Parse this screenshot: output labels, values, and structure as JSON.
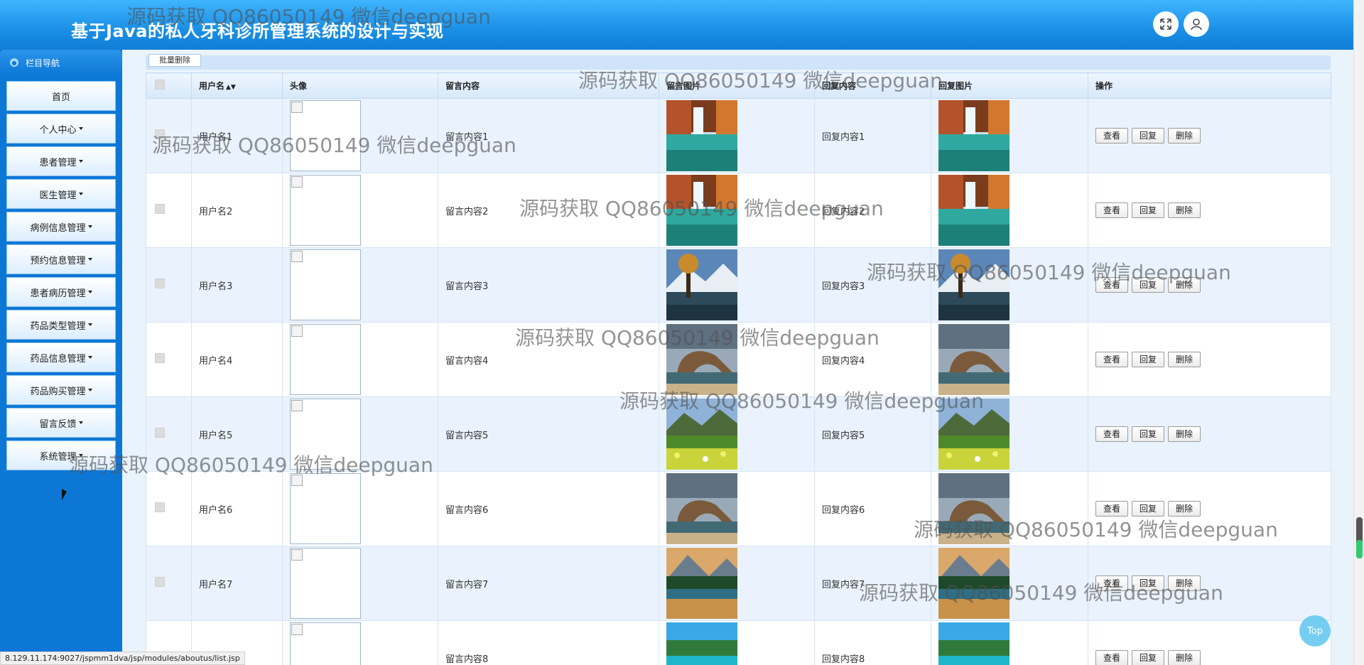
{
  "app": {
    "title": "基于Java的私人牙科诊所管理系统的设计与实现"
  },
  "header_icons": [
    "fullscreen-icon",
    "user-icon"
  ],
  "sidebar": {
    "heading": "栏目导航",
    "items": [
      {
        "label": "首页",
        "dropdown": false
      },
      {
        "label": "个人中心",
        "dropdown": true
      },
      {
        "label": "患者管理",
        "dropdown": true
      },
      {
        "label": "医生管理",
        "dropdown": true
      },
      {
        "label": "病例信息管理",
        "dropdown": true
      },
      {
        "label": "预约信息管理",
        "dropdown": true
      },
      {
        "label": "患者病历管理",
        "dropdown": true
      },
      {
        "label": "药品类型管理",
        "dropdown": true
      },
      {
        "label": "药品信息管理",
        "dropdown": true
      },
      {
        "label": "药品购买管理",
        "dropdown": true
      },
      {
        "label": "留言反馈",
        "dropdown": true
      },
      {
        "label": "系统管理",
        "dropdown": true
      }
    ]
  },
  "toolbar": {
    "batch_delete_label": "批量删除"
  },
  "table": {
    "columns": [
      "用户名",
      "头像",
      "留言内容",
      "留言图片",
      "回复内容",
      "回复图片",
      "操作"
    ],
    "rows": [
      {
        "username": "用户名1",
        "message": "留言内容1",
        "reply": "回复内容1",
        "image": "lake-autumn"
      },
      {
        "username": "用户名2",
        "message": "留言内容2",
        "reply": "回复内容2",
        "image": "lake-autumn"
      },
      {
        "username": "用户名3",
        "message": "留言内容3",
        "reply": "回复内容3",
        "image": "tree-mountain-lake"
      },
      {
        "username": "用户名4",
        "message": "留言内容4",
        "reply": "回复内容4",
        "image": "sea-arch"
      },
      {
        "username": "用户名5",
        "message": "留言内容5",
        "reply": "回复内容5",
        "image": "flower-meadow"
      },
      {
        "username": "用户名6",
        "message": "留言内容6",
        "reply": "回复内容6",
        "image": "sea-arch"
      },
      {
        "username": "用户名7",
        "message": "留言内容7",
        "reply": "回复内容7",
        "image": "forest-lake"
      },
      {
        "username": "",
        "message": "留言内容8",
        "reply": "回复内容8",
        "image": "tropical-island"
      }
    ],
    "actions": {
      "view": "查看",
      "reply": "回复",
      "delete": "删除"
    }
  },
  "watermark": "源码获取 QQ86050149 微信deepguan",
  "status_url": "8.129.11.174:9027/jspmm1dva/jsp/modules/aboutus/list.jsp",
  "back_to_top": "Top"
}
